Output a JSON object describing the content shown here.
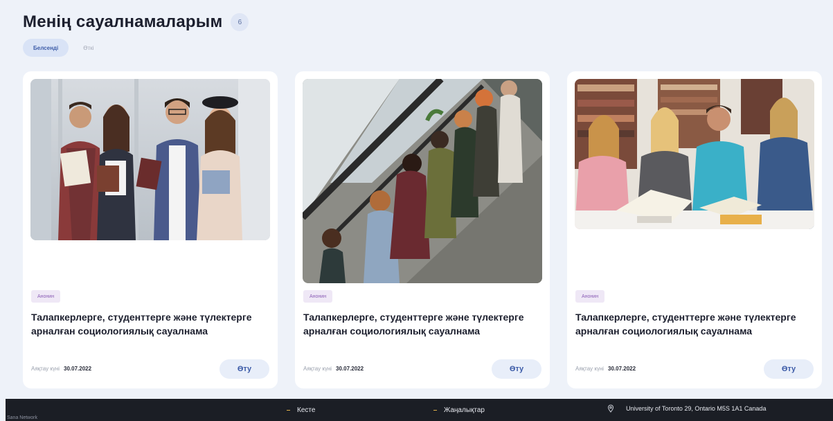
{
  "header": {
    "title": "Менің сауалнамаларым",
    "count": "6"
  },
  "tabs": [
    {
      "label": "Белсенді",
      "active": true
    },
    {
      "label": "Өткі",
      "active": false
    }
  ],
  "cards": [
    {
      "image": "students-group-photo",
      "tag": "Анонин",
      "title_line1": "Талапкерлерге, студенттерге және түлектерге",
      "title_line2": "арналған социологиялық сауалнама",
      "deadline_label": "Аяқтау күні",
      "deadline_date": "30.07.2022",
      "button": "Өту"
    },
    {
      "image": "students-with-phones-photo",
      "tag": "Анонин",
      "title_line1": "Талапкерлерге, студенттерге және түлектерге",
      "title_line2": "арналған социологиялық сауалнама",
      "deadline_label": "Аяқтау күні",
      "deadline_date": "30.07.2022",
      "button": "Өту"
    },
    {
      "image": "students-in-library-photo",
      "tag": "Анонин",
      "title_line1": "Талапкерлерге, студенттерге және түлектерге",
      "title_line2": "арналған социологиялық сауалнама",
      "deadline_label": "Аяқтау күні",
      "deadline_date": "30.07.2022",
      "button": "Өту"
    }
  ],
  "footer": {
    "link1": "Кесте",
    "link2": "Жаңалықтар",
    "address": "University of Toronto 29, Ontario M5S 1A1 Canada",
    "corner": "Sana Network"
  },
  "colors": {
    "background": "#eef2f9",
    "accent": "#3d5ca8",
    "tag": "#8a5cb5",
    "footer": "#1b1e25"
  }
}
